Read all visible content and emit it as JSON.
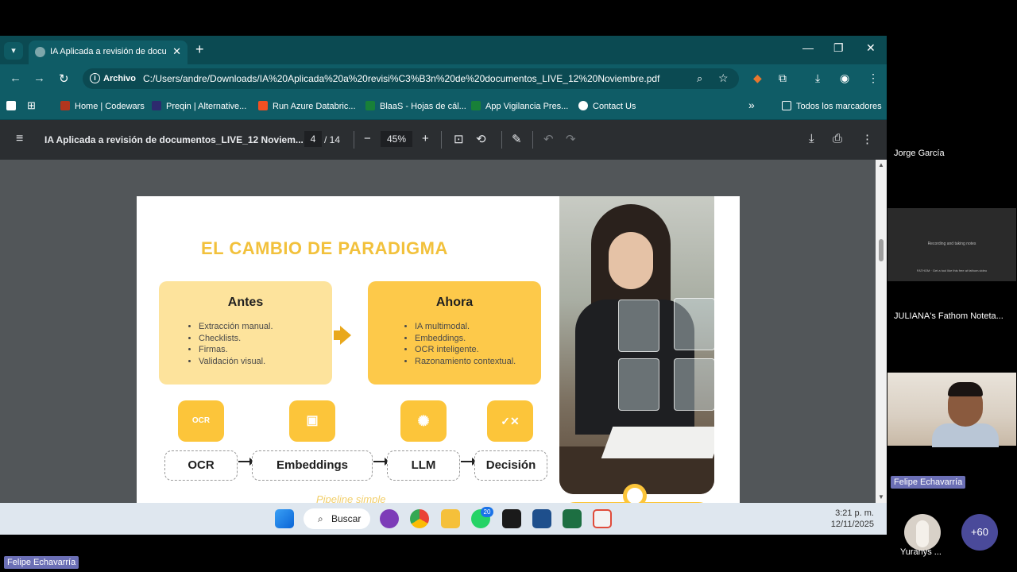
{
  "browser": {
    "tab_title": "IA Aplicada a revisión de docum",
    "new_tab": "+",
    "close_tab": "✕",
    "window_controls": {
      "minimize": "—",
      "maximize": "❐",
      "close": "✕"
    }
  },
  "address_bar": {
    "scheme_label": "Archivo",
    "url": "C:/Users/andre/Downloads/IA%20Aplicada%20a%20revisi%C3%B3n%20de%20documentos_LIVE_12%20Noviembre.pdf"
  },
  "bookmarks": {
    "items": [
      {
        "label": "Home | Codewars",
        "color": "#b1361e"
      },
      {
        "label": "Preqin | Alternative...",
        "color": "#2d2a6e"
      },
      {
        "label": "Run Azure Databric...",
        "color": "#f25022"
      },
      {
        "label": "BlaaS - Hojas de cál...",
        "color": "#188038"
      },
      {
        "label": "App Vigilancia Pres...",
        "color": "#188038"
      },
      {
        "label": "Contact Us",
        "color": "#ffffff"
      }
    ],
    "overflow": "»",
    "all_bookmarks": "Todos los marcadores"
  },
  "pdf_toolbar": {
    "title": "IA Aplicada a revisión de documentos_LIVE_12 Noviem...",
    "page_current": "4",
    "page_total": "/ 14",
    "zoom": "45%",
    "zoom_out": "−",
    "zoom_in": "+"
  },
  "slide": {
    "title": "EL CAMBIO DE PARADIGMA",
    "before": {
      "heading": "Antes",
      "items": [
        "Extracción manual.",
        "Checklists.",
        "Firmas.",
        "Validación visual."
      ]
    },
    "after": {
      "heading": "Ahora",
      "items": [
        "IA multimodal.",
        "Embeddings.",
        "OCR inteligente.",
        "Razonamiento contextual."
      ]
    },
    "pipeline": [
      "OCR",
      "Embeddings",
      "LLM",
      "Decisión"
    ],
    "caption": "Pipeline simple",
    "ocr_icon_text": "OCR"
  },
  "taskbar": {
    "search_label": "Buscar",
    "whatsapp_badge": "20",
    "time": "3:21 p. m.",
    "date": "12/11/2025"
  },
  "meeting": {
    "participants": [
      "Jorge García",
      "JULIANA's Fathom Noteta...",
      "Felipe Echavarría",
      "Yuranys ..."
    ],
    "rec_tile_text": "Recording and taking notes",
    "rec_tile_footer": "FATHOM · Get a tool like this free at fathom.video",
    "presenter_tag": "Felipe Echavarría",
    "more_count": "+60"
  }
}
